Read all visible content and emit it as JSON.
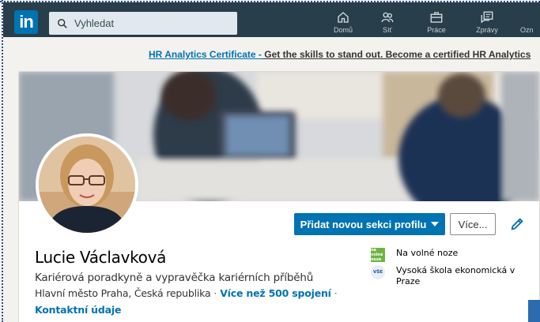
{
  "navbar": {
    "search_placeholder": "Vyhledat",
    "items": [
      {
        "label": "Domů",
        "icon": "home-icon"
      },
      {
        "label": "Síť",
        "icon": "network-icon"
      },
      {
        "label": "Práce",
        "icon": "jobs-icon"
      },
      {
        "label": "Zprávy",
        "icon": "messaging-icon"
      },
      {
        "label": "Ozn",
        "icon": "notifications-icon"
      }
    ]
  },
  "promo": {
    "link_text": "HR Analytics Certificate -",
    "rest_text": " Get the skills to stand out. Become a certified HR Analytics"
  },
  "profile": {
    "name": "Lucie Václavková",
    "headline": "Kariérová poradkyně a vypravěčka kariérních příběhů",
    "location": "Hlavní město Praha, Česká republika",
    "connections": "Více než 500 spojení",
    "contact": "Kontaktní údaje",
    "separator": "·",
    "add_section_label": "Přidat novou sekci profilu",
    "more_label": "Více...",
    "experience": [
      {
        "logo_text": "na volné noze",
        "label": "Na volné noze"
      },
      {
        "logo_text": "VŠE",
        "label": "Vysoká škola ekonomická v Praze"
      }
    ]
  },
  "colors": {
    "navbar_bg": "#283e4a",
    "brand_blue": "#0073b1",
    "page_bg": "#f3f2ef"
  }
}
